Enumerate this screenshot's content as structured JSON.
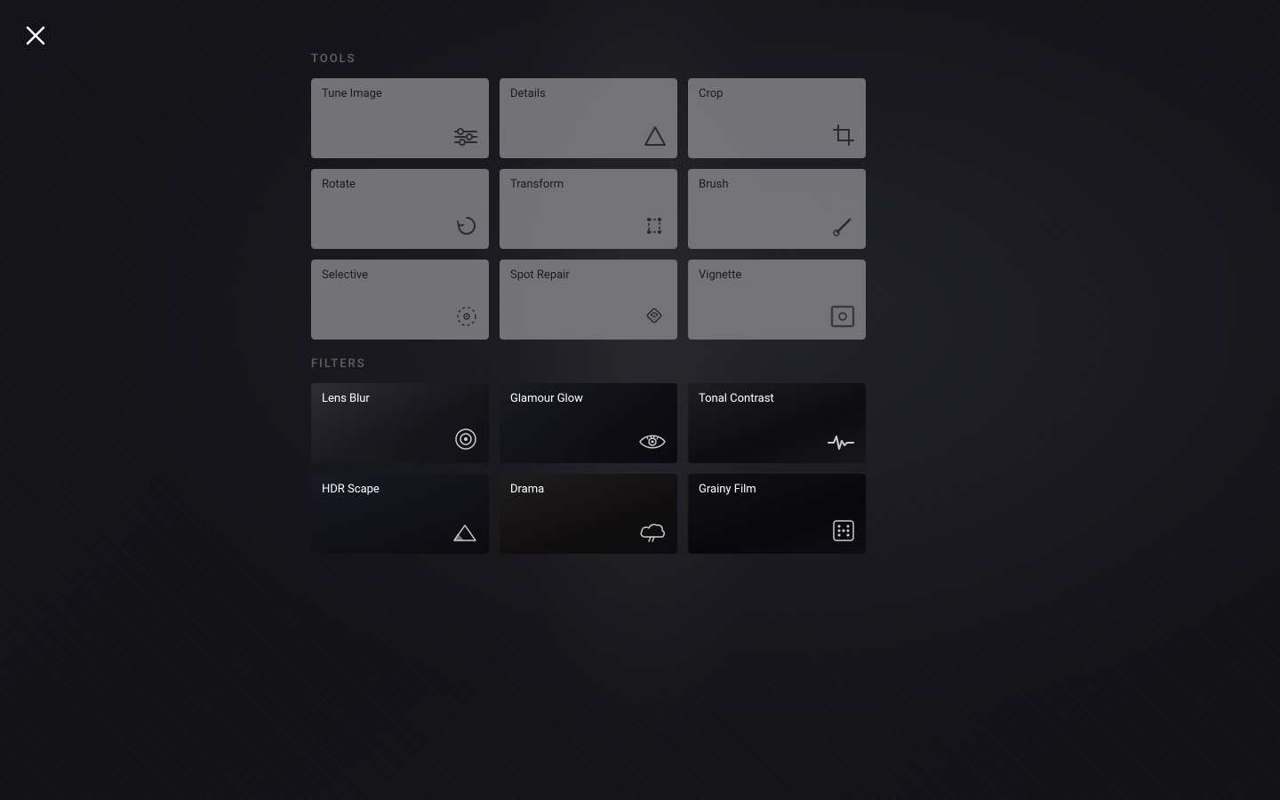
{
  "close_label": "×",
  "sections": {
    "tools": {
      "label": "TOOLS",
      "items": [
        {
          "id": "tune-image",
          "label": "Tune Image",
          "icon": "sliders",
          "type": "tool"
        },
        {
          "id": "details",
          "label": "Details",
          "icon": "triangle",
          "type": "tool"
        },
        {
          "id": "crop",
          "label": "Crop",
          "icon": "crop",
          "type": "tool"
        },
        {
          "id": "rotate",
          "label": "Rotate",
          "icon": "rotate",
          "type": "tool"
        },
        {
          "id": "transform",
          "label": "Transform",
          "icon": "transform",
          "type": "tool"
        },
        {
          "id": "brush",
          "label": "Brush",
          "icon": "brush",
          "type": "tool"
        },
        {
          "id": "selective",
          "label": "Selective",
          "icon": "selective",
          "type": "tool"
        },
        {
          "id": "spot-repair",
          "label": "Spot Repair",
          "icon": "bandaid",
          "type": "tool"
        },
        {
          "id": "vignette",
          "label": "Vignette",
          "icon": "vignette",
          "type": "tool"
        }
      ]
    },
    "filters": {
      "label": "FILTERS",
      "items": [
        {
          "id": "lens-blur",
          "label": "Lens Blur",
          "icon": "eye-circle",
          "class": "lens-blur",
          "type": "filter"
        },
        {
          "id": "glamour-glow",
          "label": "Glamour Glow",
          "icon": "eye",
          "class": "glamour-glow",
          "type": "filter"
        },
        {
          "id": "tonal-contrast",
          "label": "Tonal Contrast",
          "icon": "pulse",
          "class": "tonal-contrast",
          "type": "filter"
        },
        {
          "id": "hdr-scape",
          "label": "HDR Scape",
          "icon": "mountain",
          "class": "hdr-scape",
          "type": "filter"
        },
        {
          "id": "drama",
          "label": "Drama",
          "icon": "cloud",
          "class": "drama",
          "type": "filter"
        },
        {
          "id": "grainy-film",
          "label": "Grainy Film",
          "icon": "dice",
          "class": "grainy-film",
          "type": "filter"
        }
      ]
    }
  }
}
